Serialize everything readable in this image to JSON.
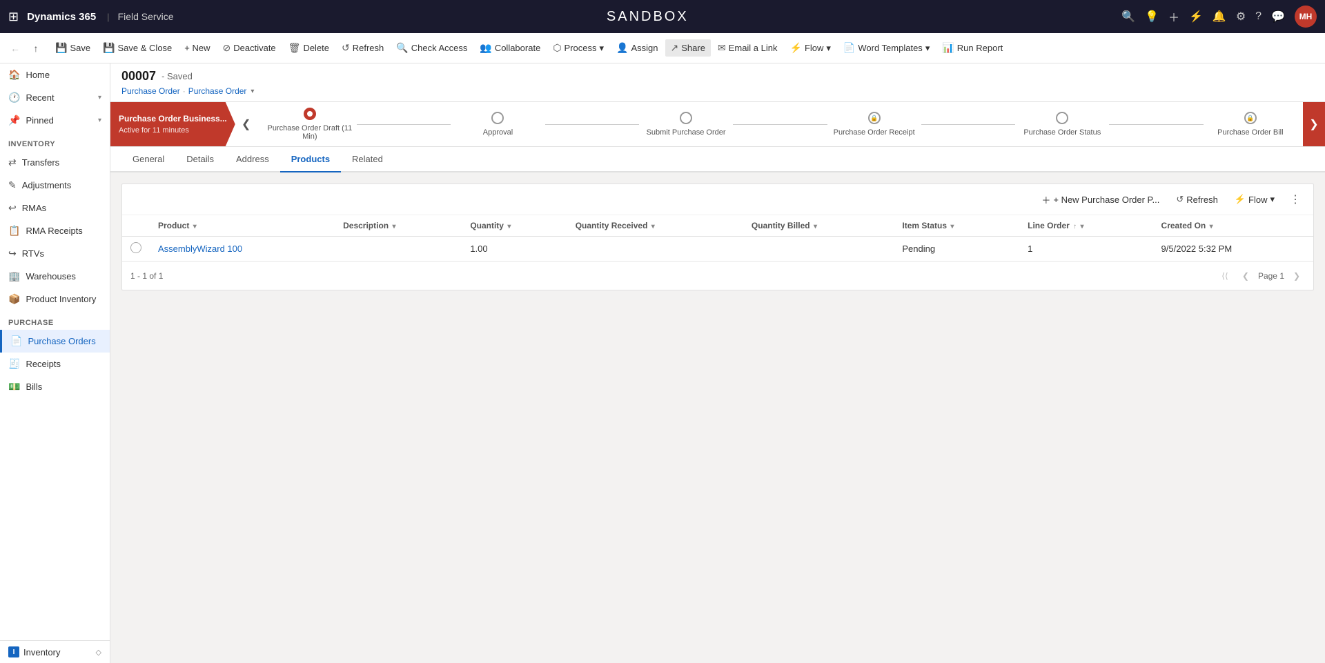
{
  "topNav": {
    "gridIconLabel": "⊞",
    "brand": "Dynamics 365",
    "separator": "|",
    "module": "Field Service",
    "sandboxTitle": "SANDBOX",
    "navIcons": [
      "search",
      "lightbulb",
      "plus",
      "filter",
      "bell",
      "settings",
      "question",
      "chat"
    ],
    "avatar": "MH"
  },
  "toolbar": {
    "backArrow": "←",
    "forwardArrow": "↑",
    "save": "Save",
    "saveClose": "Save & Close",
    "new": "+ New",
    "deactivate": "Deactivate",
    "delete": "Delete",
    "refresh": "Refresh",
    "checkAccess": "Check Access",
    "collaborate": "Collaborate",
    "process": "Process",
    "assign": "Assign",
    "share": "Share",
    "emailLink": "Email a Link",
    "flow": "Flow",
    "wordTemplates": "Word Templates",
    "runReport": "Run Report"
  },
  "sidebar": {
    "home": "Home",
    "recent": "Recent",
    "pinned": "Pinned",
    "inventorySection": "Inventory",
    "inventoryItems": [
      {
        "label": "Transfers",
        "icon": "⇄"
      },
      {
        "label": "Adjustments",
        "icon": "✎"
      },
      {
        "label": "RMAs",
        "icon": "↩"
      },
      {
        "label": "RMA Receipts",
        "icon": "📋"
      },
      {
        "label": "RTVs",
        "icon": "↪"
      },
      {
        "label": "Warehouses",
        "icon": "🏢"
      },
      {
        "label": "Product Inventory",
        "icon": "📦"
      }
    ],
    "purchaseSection": "Purchase",
    "purchaseItems": [
      {
        "label": "Purchase Orders",
        "icon": "📄",
        "active": true
      },
      {
        "label": "Receipts",
        "icon": "🧾"
      },
      {
        "label": "Bills",
        "icon": "💵"
      }
    ],
    "bottomLabel": "Inventory",
    "bottomIcon": "I"
  },
  "record": {
    "number": "00007",
    "status": "- Saved",
    "type": "Purchase Order",
    "breadcrumbSeparator": "·",
    "breadcrumbLink": "Purchase Order",
    "breadcrumbDropdown": "▾"
  },
  "processBar": {
    "activeStage": "Purchase Order Business...",
    "activeTime": "Active for 11 minutes",
    "leftArrow": "❮",
    "rightArrow": "❯",
    "stages": [
      {
        "label": "Purchase Order Draft  (11 Min)",
        "type": "active",
        "locked": false
      },
      {
        "label": "Approval",
        "type": "normal",
        "locked": false
      },
      {
        "label": "Submit Purchase Order",
        "type": "normal",
        "locked": false
      },
      {
        "label": "Purchase Order Receipt",
        "type": "normal",
        "locked": true
      },
      {
        "label": "Purchase Order Status",
        "type": "normal",
        "locked": false
      },
      {
        "label": "Purchase Order Bill",
        "type": "normal",
        "locked": true
      }
    ]
  },
  "tabs": [
    {
      "label": "General",
      "active": false
    },
    {
      "label": "Details",
      "active": false
    },
    {
      "label": "Address",
      "active": false
    },
    {
      "label": "Products",
      "active": true
    },
    {
      "label": "Related",
      "active": false
    }
  ],
  "subgrid": {
    "newButton": "+ New Purchase Order P...",
    "refreshButton": "Refresh",
    "flowButton": "Flow",
    "moreOptions": "⋮",
    "columns": [
      {
        "label": "Product",
        "sortable": true
      },
      {
        "label": "Description",
        "sortable": true
      },
      {
        "label": "Quantity",
        "sortable": true
      },
      {
        "label": "Quantity Received",
        "sortable": true
      },
      {
        "label": "Quantity Billed",
        "sortable": true
      },
      {
        "label": "Item Status",
        "sortable": true
      },
      {
        "label": "Line Order",
        "sortable": true,
        "sortDir": "↑"
      },
      {
        "label": "Created On",
        "sortable": true
      }
    ],
    "rows": [
      {
        "product": "AssemblyWizard 100",
        "description": "",
        "quantity": "1.00",
        "quantityReceived": "",
        "quantityBilled": "",
        "itemStatus": "Pending",
        "lineOrder": "1",
        "createdOn": "9/5/2022 5:32 PM"
      }
    ],
    "pagination": {
      "info": "1 - 1 of 1",
      "page": "Page 1",
      "firstIcon": "⟨⟨",
      "prevIcon": "❮",
      "nextIcon": "❯"
    }
  }
}
